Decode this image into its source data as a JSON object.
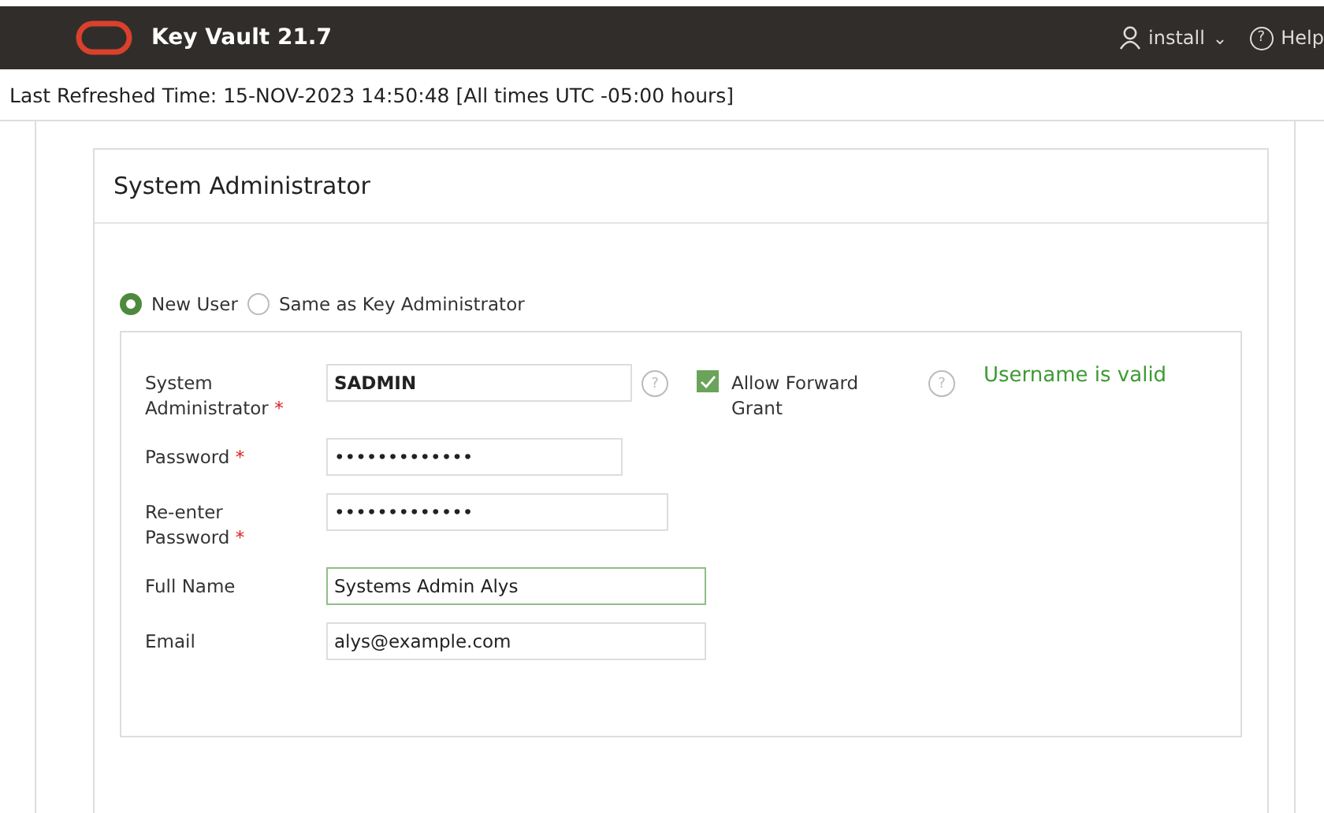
{
  "header": {
    "title": "Key Vault 21.7",
    "user_menu": "install",
    "user_caret": "⌄",
    "help": {
      "glyph": "?",
      "label": "Help"
    }
  },
  "refresh_bar": {
    "text": "Last Refreshed Time: 15-NOV-2023 14:50:48 [All times UTC -05:00 hours]"
  },
  "card": {
    "title": "System Administrator",
    "radios": [
      {
        "label": "New User",
        "selected": true
      },
      {
        "label": "Same as Key Administrator",
        "selected": false
      }
    ],
    "fields": [
      {
        "label": "System Administrator",
        "required_mark": "*",
        "value": "SADMIN",
        "focused": false,
        "help": "?"
      },
      {
        "label": "Password",
        "required_mark": "*",
        "value": "•••••••••••••",
        "focused": false
      },
      {
        "label": "Re-enter Password",
        "required_mark": "*",
        "value": "•••••••••••••",
        "focused": false
      },
      {
        "label": "Full Name",
        "value": "Systems Admin Alys",
        "focused": true
      },
      {
        "label": "Email",
        "value": "alys@example.com",
        "focused": false
      }
    ],
    "checkbox": {
      "label": "Allow Forward Grant",
      "checked": true,
      "help": "?"
    },
    "validation": "Username is valid"
  }
}
